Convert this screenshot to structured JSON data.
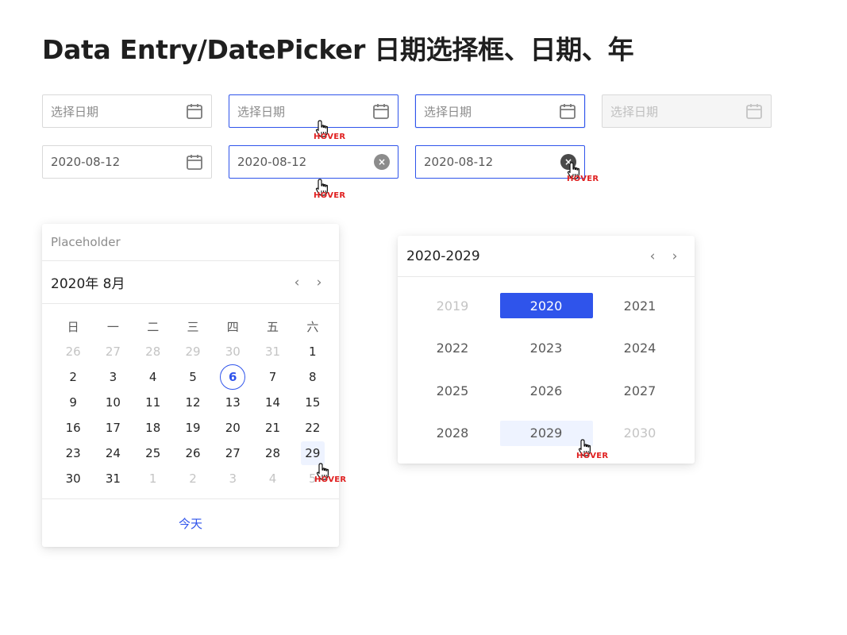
{
  "title": "Data Entry/DatePicker 日期选择框、日期、年",
  "hover_label": "HOVER",
  "pickers": {
    "placeholder": "选择日期",
    "date_value": "2020-08-12",
    "clear_glyph": "×",
    "icons": {
      "calendar": "calendar-icon",
      "clear": "clear-circle-icon",
      "cursor": "hand-pointer-icon"
    }
  },
  "date_panel": {
    "placeholder": "Placeholder",
    "month_title": "2020年 8月",
    "prev": "‹",
    "next": "›",
    "weekdays": [
      "日",
      "一",
      "二",
      "三",
      "四",
      "五",
      "六"
    ],
    "weeks": [
      [
        "26",
        "27",
        "28",
        "29",
        "30",
        "31",
        "1"
      ],
      [
        "2",
        "3",
        "4",
        "5",
        "6",
        "7",
        "8"
      ],
      [
        "9",
        "10",
        "11",
        "12",
        "13",
        "14",
        "15"
      ],
      [
        "16",
        "17",
        "18",
        "19",
        "20",
        "21",
        "22"
      ],
      [
        "23",
        "24",
        "25",
        "26",
        "27",
        "28",
        "29"
      ],
      [
        "30",
        "31",
        "1",
        "2",
        "3",
        "4",
        "5"
      ]
    ],
    "today_button": "今天"
  },
  "year_panel": {
    "range_title": "2020-2029",
    "prev": "‹",
    "next": "›",
    "years": [
      [
        "2019",
        "2020",
        "2021"
      ],
      [
        "2022",
        "2023",
        "2024"
      ],
      [
        "2025",
        "2026",
        "2027"
      ],
      [
        "2028",
        "2029",
        "2030"
      ]
    ]
  },
  "colors": {
    "accent": "#2f54eb",
    "hover_bg": "#eef3ff",
    "hover_tag": "#e02020",
    "disabled_bg": "#f5f5f5"
  }
}
